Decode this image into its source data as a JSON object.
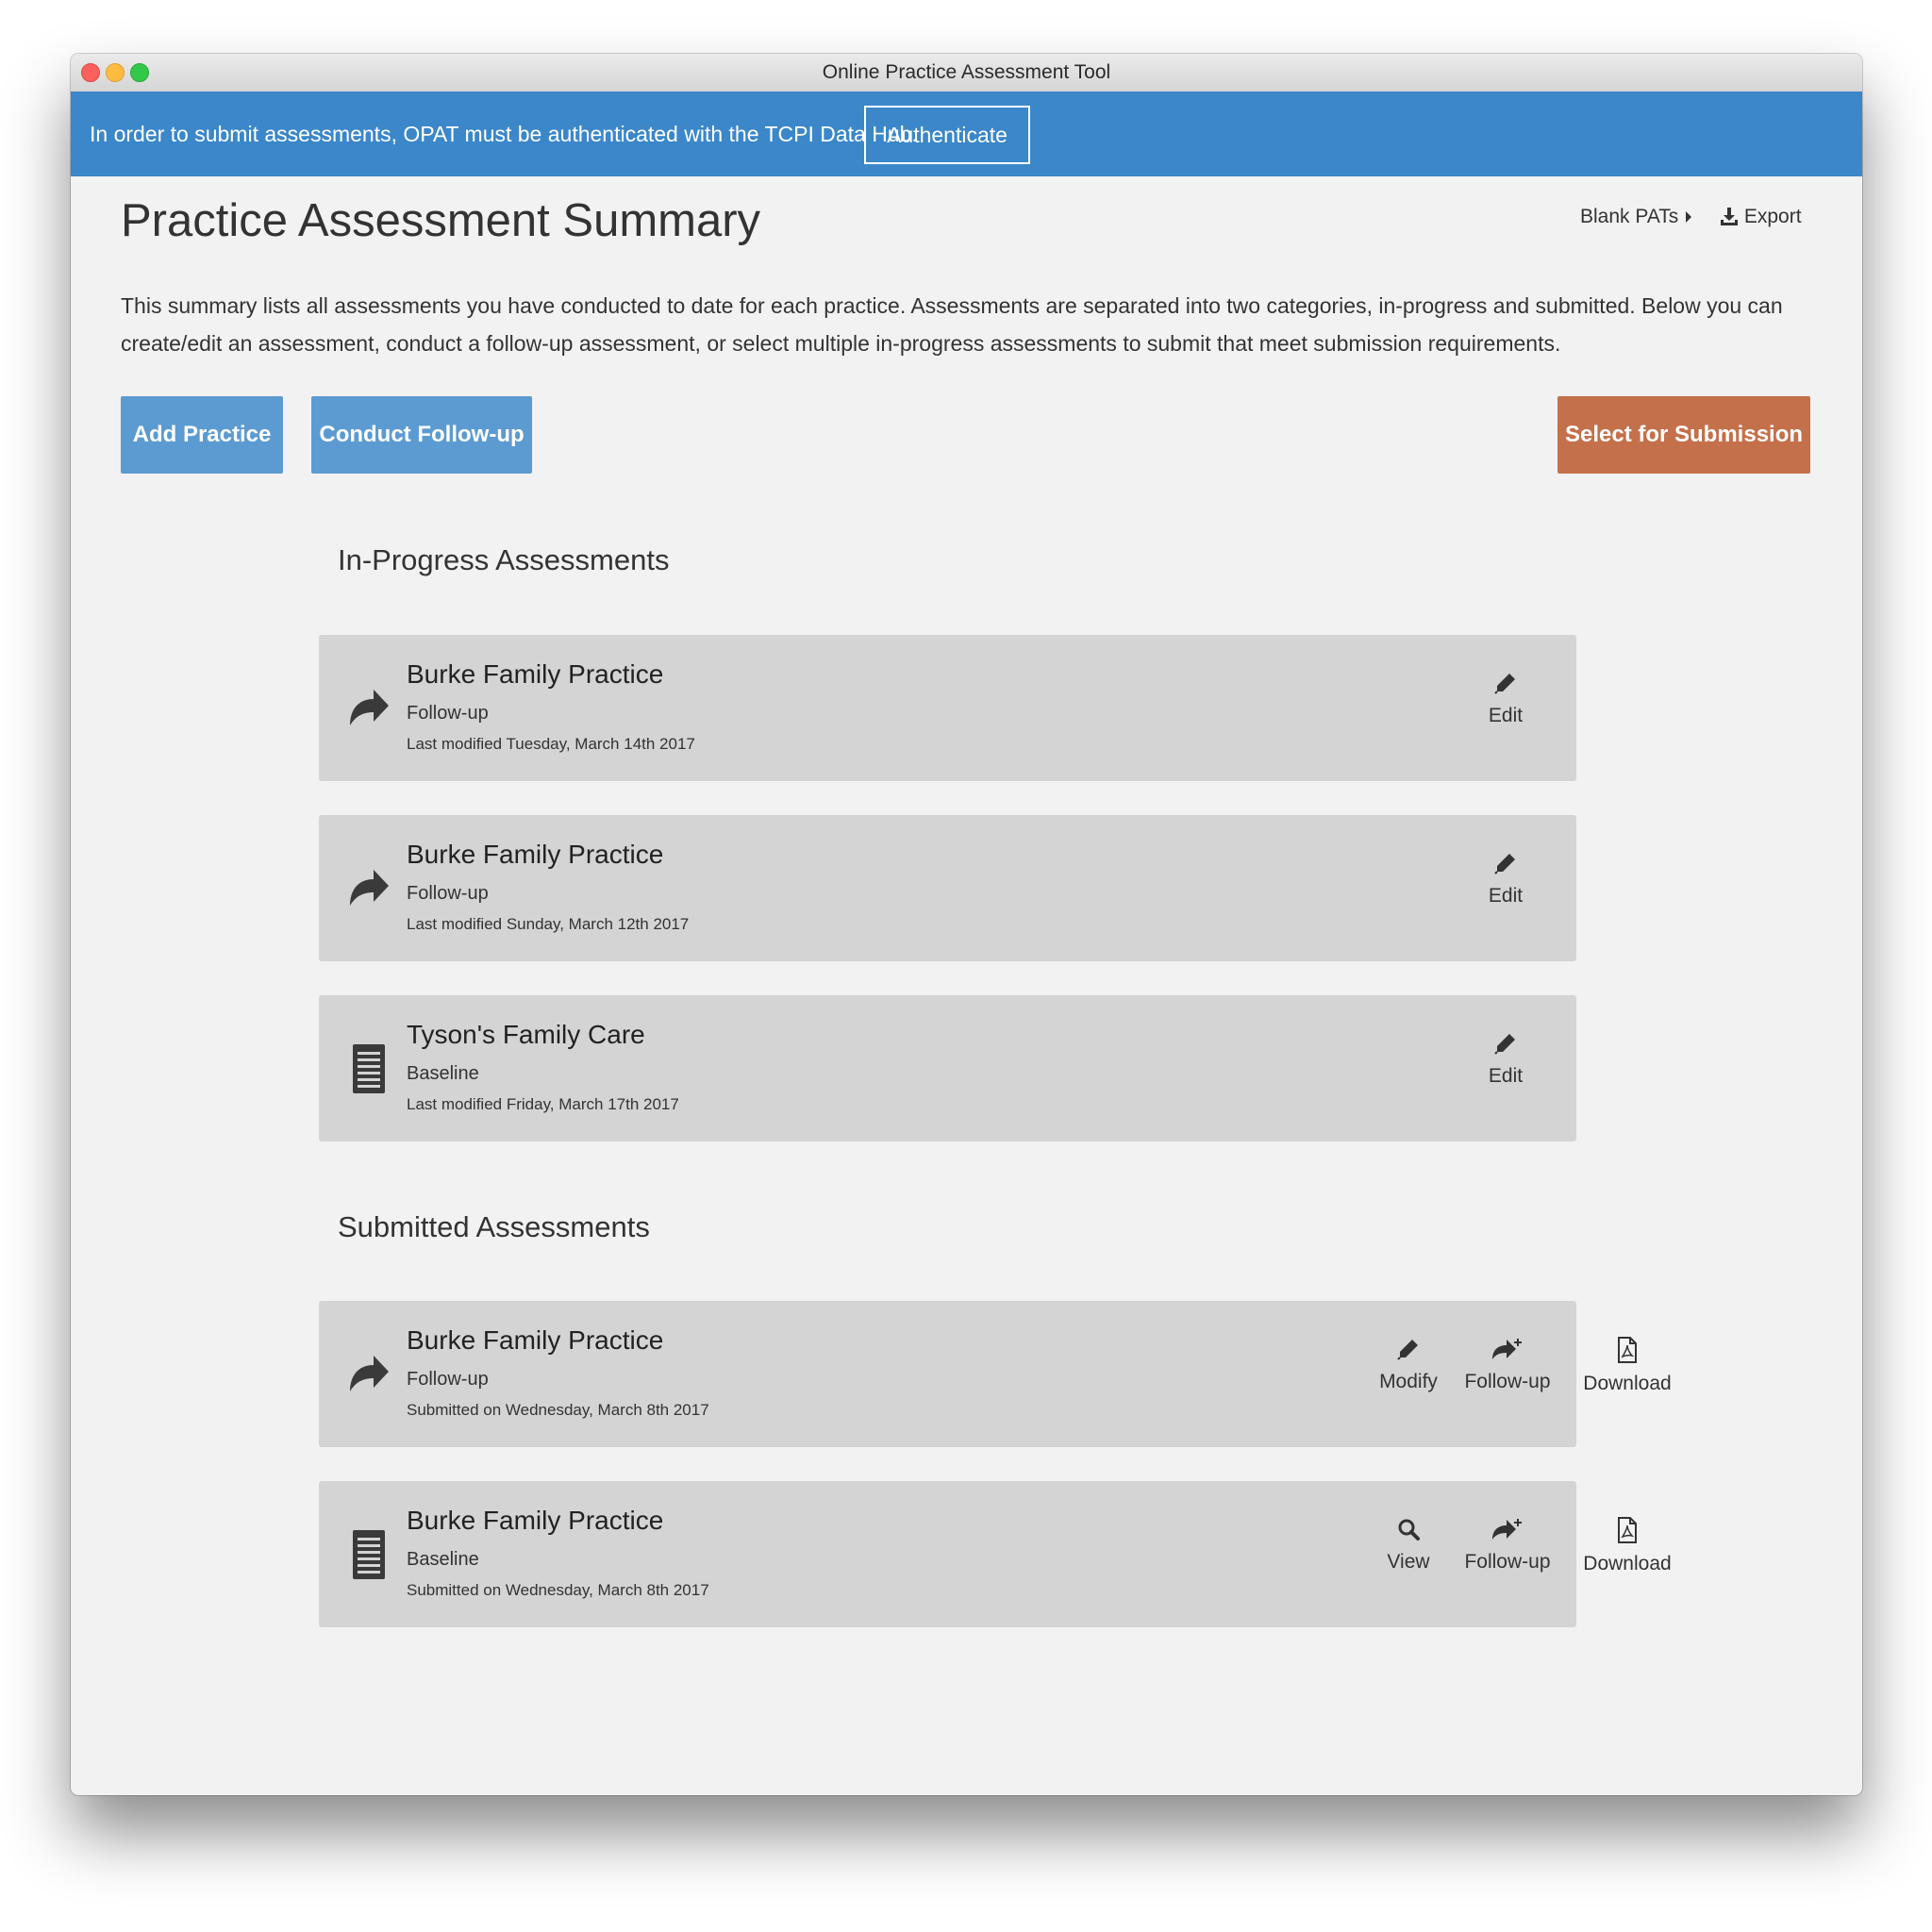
{
  "window": {
    "title": "Online Practice Assessment Tool"
  },
  "banner": {
    "message": "In order to submit assessments, OPAT must be authenticated with the TCPI Data Hub.",
    "authenticate_label": "Authenticate"
  },
  "header": {
    "page_title": "Practice Assessment Summary",
    "blank_pats_label": "Blank PATs",
    "export_label": "Export"
  },
  "intro": "This summary lists all assessments you have conducted to date for each practice. Assessments are separated into two categories, in-progress and submitted. Below you can create/edit an assessment, conduct a follow-up assessment, or select multiple in-progress assessments to submit that meet submission requirements.",
  "actions": {
    "add_practice": "Add Practice",
    "conduct_followup": "Conduct Follow-up",
    "select_submission": "Select for Submission"
  },
  "colors": {
    "banner": "#3b87c9",
    "primary_button": "#5c9bd1",
    "submit_button": "#c4704b",
    "card": "#d4d4d4",
    "page_bg": "#f2f2f2"
  },
  "in_progress": {
    "title": "In-Progress Assessments",
    "items": [
      {
        "name": "Burke Family Practice",
        "type": "Follow-up",
        "date": "Last modified Tuesday, March 14th 2017",
        "icon": "share-arrow-icon",
        "action": "Edit"
      },
      {
        "name": "Burke Family Practice",
        "type": "Follow-up",
        "date": "Last modified Sunday, March 12th 2017",
        "icon": "share-arrow-icon",
        "action": "Edit"
      },
      {
        "name": "Tyson's Family Care",
        "type": "Baseline",
        "date": "Last modified Friday, March 17th 2017",
        "icon": "list-document-icon",
        "action": "Edit"
      }
    ]
  },
  "submitted": {
    "title": "Submitted Assessments",
    "items": [
      {
        "name": "Burke Family Practice",
        "type": "Follow-up",
        "date": "Submitted on Wednesday, March 8th 2017",
        "icon": "share-arrow-icon",
        "actions": [
          "Modify",
          "Follow-up",
          "Download"
        ]
      },
      {
        "name": "Burke Family Practice",
        "type": "Baseline",
        "date": "Submitted on Wednesday, March 8th 2017",
        "icon": "list-document-icon",
        "actions": [
          "View",
          "Follow-up",
          "Download"
        ]
      }
    ]
  }
}
